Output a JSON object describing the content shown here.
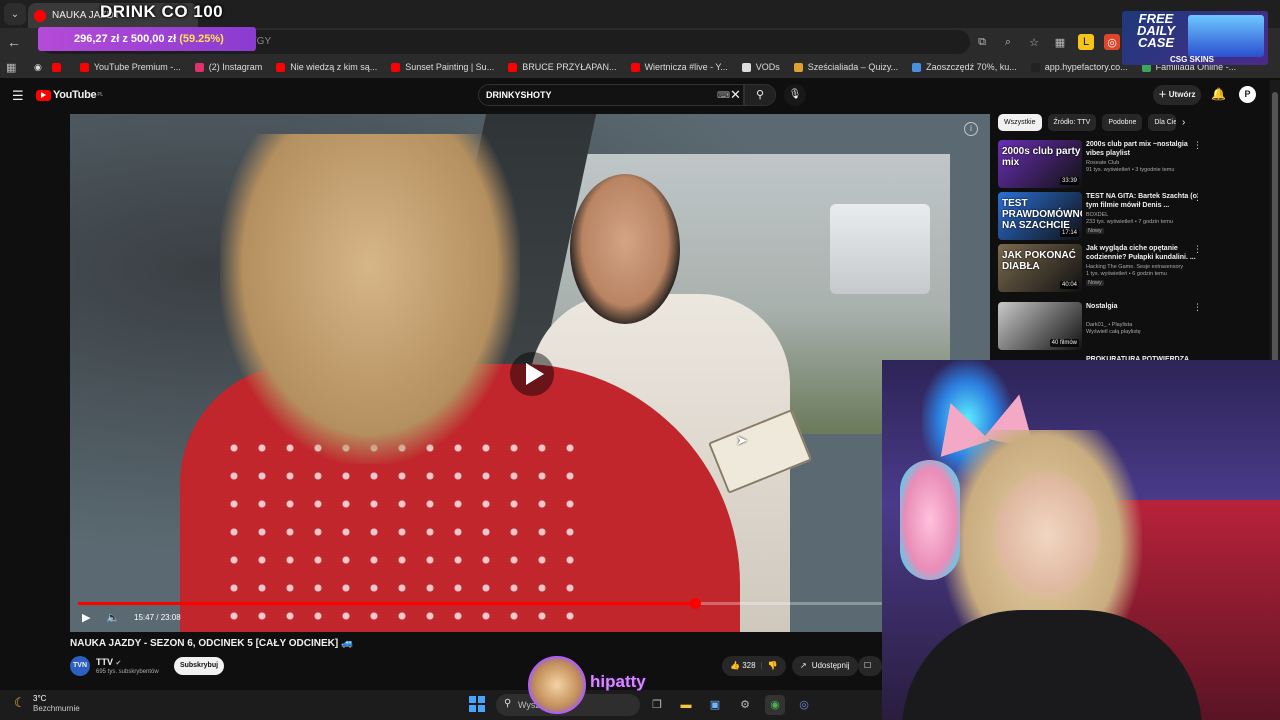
{
  "browser": {
    "tab_title": "NAUKA JAZDY",
    "overlay_title": "DRINK CO 100",
    "url_fragment": "3TGY",
    "bookmarks": [
      {
        "label": "",
        "color": "#ff0000"
      },
      {
        "label": "YouTube Premium -...",
        "color": "#ff0000"
      },
      {
        "label": "(2) Instagram",
        "color": "#e1306c"
      },
      {
        "label": "Nie wiedzą z kim są...",
        "color": "#ff0000"
      },
      {
        "label": "Sunset Painting | Su...",
        "color": "#ff0000"
      },
      {
        "label": "BRUCE PRZYŁAPAN...",
        "color": "#ff0000"
      },
      {
        "label": "Wiertnicza #live - Y...",
        "color": "#ff0000"
      },
      {
        "label": "VODs",
        "color": "#dddddd"
      },
      {
        "label": "Sześcialiada – Quizy...",
        "color": "#e0a030"
      },
      {
        "label": "Zaoszczędź 70%, ku...",
        "color": "#4a90e2"
      },
      {
        "label": "app.hypefactory.co...",
        "color": "#222222"
      },
      {
        "label": "Familiada Online -...",
        "color": "#3ba55c"
      }
    ]
  },
  "donation": {
    "amount": "296,27 zł z 500,00 zł",
    "percent": "(59.25%)",
    "progress": 0.5925
  },
  "csg_ad": {
    "line1": "FREE",
    "line2": "DAILY",
    "line3": "CASE",
    "brand": "CSG SKINS"
  },
  "youtube": {
    "logo": "YouTube",
    "logo_country": "PL",
    "search_value": "DRINKYSHOTY",
    "create_label": "Utwórz",
    "video": {
      "title": "NAUKA JAZDY - SEZON 6, ODCINEK 5 [CAŁY ODCINEK] 🚙",
      "time": "15:47 / 23:08",
      "progress": 0.682
    },
    "channel": {
      "name": "TTV",
      "subscribers": "695 tys. subskrybentów",
      "subscribe_label": "Subskrybuj"
    },
    "actions": {
      "likes": "328",
      "share_label": "Udostępnij"
    },
    "chips": [
      "Wszystkie",
      "Źródło: TTV",
      "Podobne",
      "Dla Ciebie"
    ],
    "recommendations": [
      {
        "title": "2000s club part mix ~nostalgia vibes playlist",
        "channel": "Roseate Club",
        "meta": "91 tys. wyświetleń • 3 tygodnie temu",
        "duration": "33:39",
        "thumb_text": "2000s club party mix",
        "thumb_color": "#6a2fb5"
      },
      {
        "title": "TEST NA GITA: Bartek Szachta (o tym filmie mówił Denis ...",
        "channel": "BOXDEL",
        "meta": "233 tys. wyświetleń • 7 godzin temu",
        "badge": "Nowy",
        "duration": "17:14",
        "thumb_text": "TEST PRAWDOMÓWNOŚCI NA SZACHCIE",
        "thumb_color": "#2a6fd6"
      },
      {
        "title": "Jak wygląda ciche opętanie codziennie? Pułapki kundalini. ...",
        "channel": "Hacking The Game. Sesje extrasensory",
        "meta": "1 tys. wyświetleń • 6 godzin temu",
        "badge": "Nowy",
        "duration": "40:04",
        "thumb_text": "JAK POKONAĆ DIABŁA",
        "thumb_color": "#7b6a4e"
      },
      {
        "title": "Nostalgia",
        "channel": "Dark01_ • Playlista",
        "meta": "Wyświetl całą playlistę",
        "duration": "40 filmów",
        "thumb_text": "",
        "thumb_color": "#c9c9c9"
      }
    ],
    "next_rec_partial": "PROKURATURA POTWIERDZA"
  },
  "taskbar": {
    "temperature": "3°C",
    "weather": "Bezchmurnie",
    "search_placeholder": "Wysz"
  },
  "streamer": {
    "name": "hipatty"
  }
}
